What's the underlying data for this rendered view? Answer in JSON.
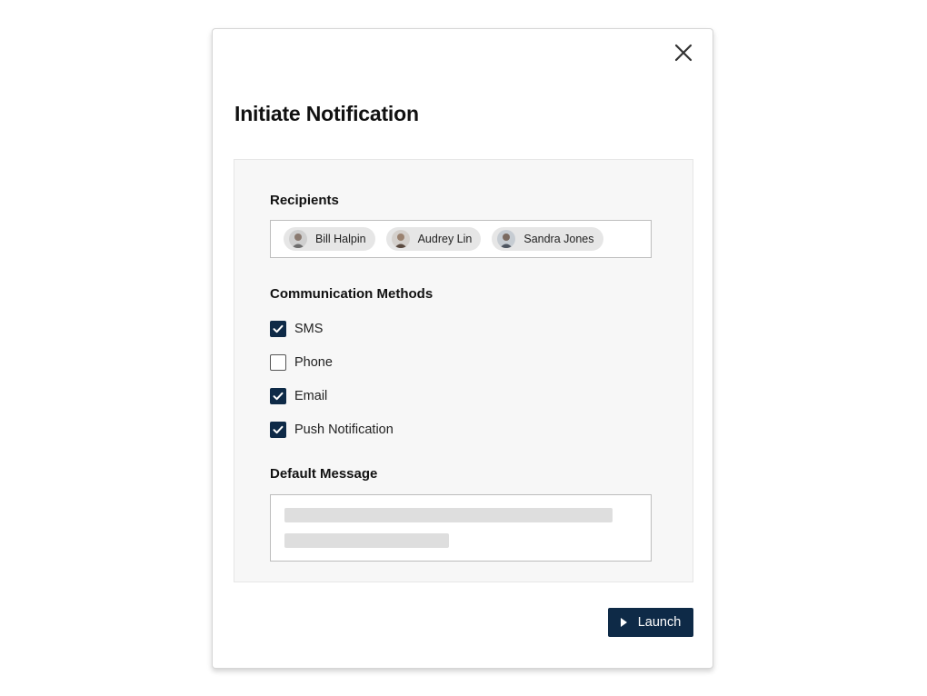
{
  "dialog": {
    "title": "Initiate Notification",
    "close_icon": "close-icon",
    "colors": {
      "primary": "#0e2a47",
      "panel_background": "#f7f7f7",
      "chip_background": "#e6e6e6"
    }
  },
  "recipients": {
    "label": "Recipients",
    "chips": [
      {
        "name": "Bill Halpin",
        "avatar": "avatar"
      },
      {
        "name": "Audrey Lin",
        "avatar": "avatar"
      },
      {
        "name": "Sandra Jones",
        "avatar": "avatar"
      }
    ]
  },
  "methods": {
    "label": "Communication Methods",
    "options": [
      {
        "label": "SMS",
        "checked": true
      },
      {
        "label": "Phone",
        "checked": false
      },
      {
        "label": "Email",
        "checked": true
      },
      {
        "label": "Push Notification",
        "checked": true
      }
    ]
  },
  "message": {
    "label": "Default Message"
  },
  "actions": {
    "launch_label": "Launch",
    "launch_icon": "play-icon"
  }
}
